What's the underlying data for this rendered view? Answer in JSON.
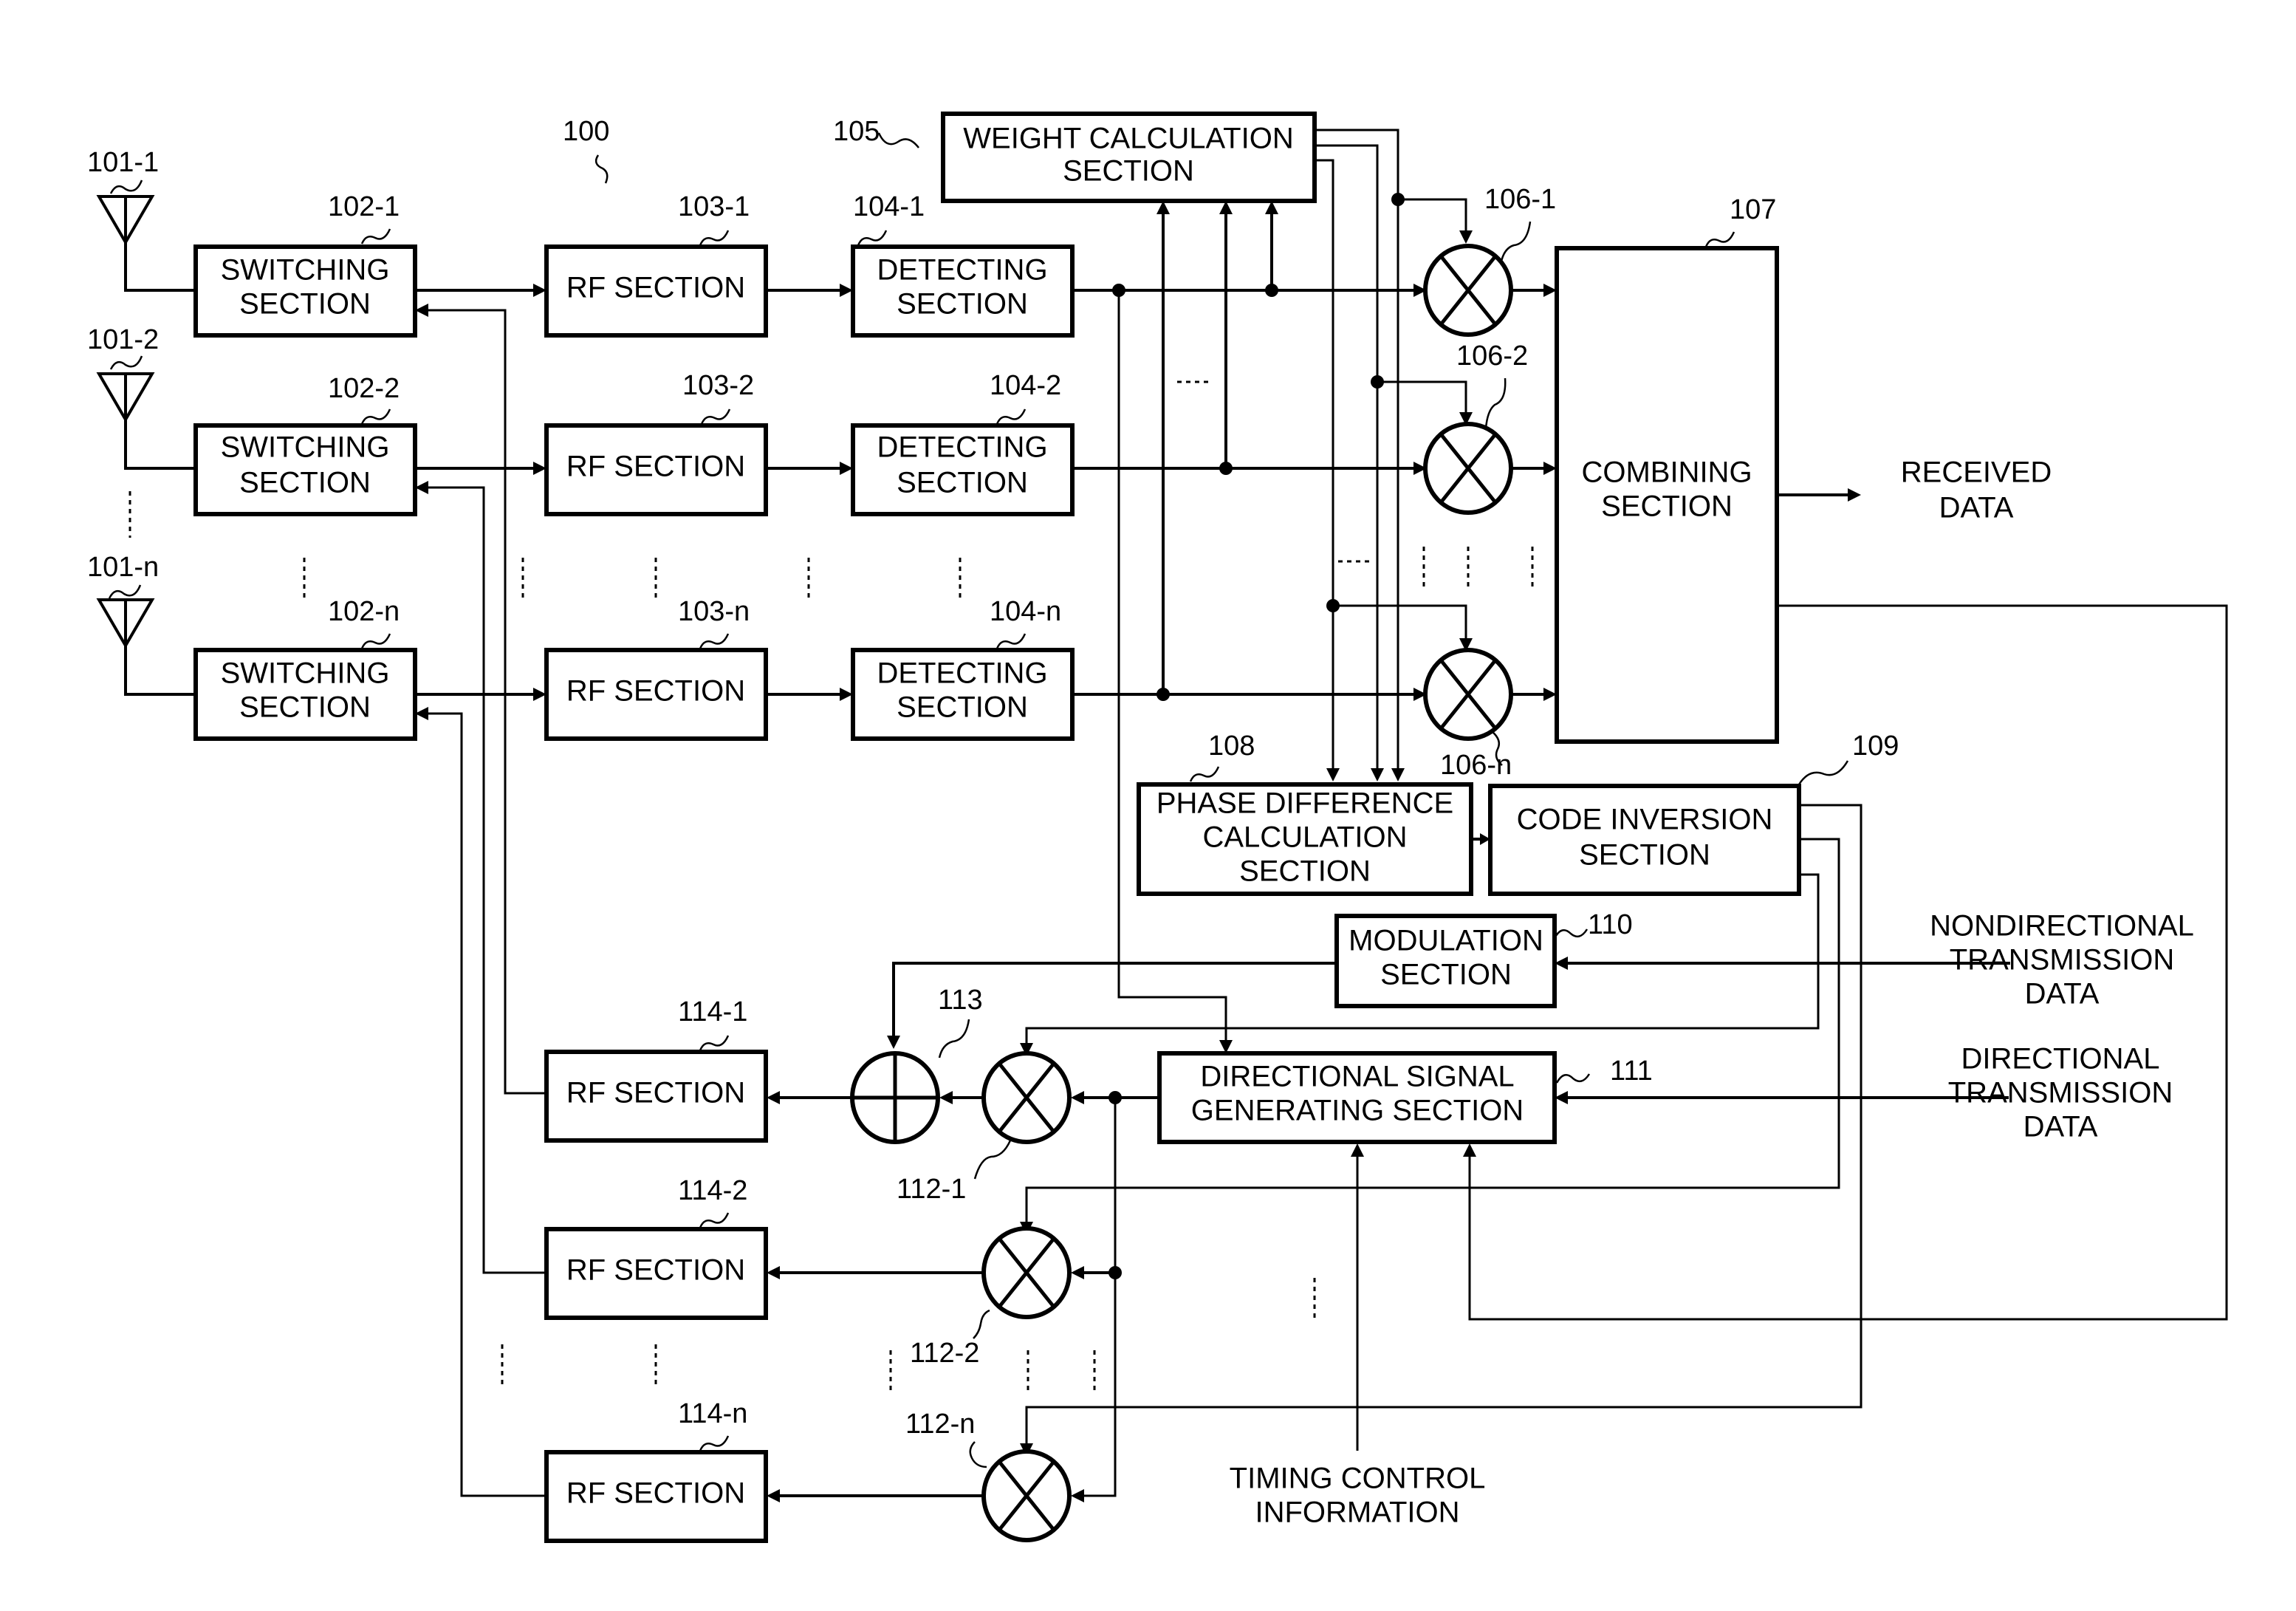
{
  "figure": {
    "ref_main": "100",
    "antennas": [
      {
        "ref": "101-1"
      },
      {
        "ref": "101-2"
      },
      {
        "ref": "101-n"
      }
    ],
    "switching": [
      {
        "ref": "102-1",
        "line1": "SWITCHING",
        "line2": "SECTION"
      },
      {
        "ref": "102-2",
        "line1": "SWITCHING",
        "line2": "SECTION"
      },
      {
        "ref": "102-n",
        "line1": "SWITCHING",
        "line2": "SECTION"
      }
    ],
    "rf_rx": [
      {
        "ref": "103-1",
        "label": "RF SECTION"
      },
      {
        "ref": "103-2",
        "label": "RF SECTION"
      },
      {
        "ref": "103-n",
        "label": "RF SECTION"
      }
    ],
    "detecting": [
      {
        "ref": "104-1",
        "line1": "DETECTING",
        "line2": "SECTION"
      },
      {
        "ref": "104-2",
        "line1": "DETECTING",
        "line2": "SECTION"
      },
      {
        "ref": "104-n",
        "line1": "DETECTING",
        "line2": "SECTION"
      }
    ],
    "weight": {
      "ref": "105",
      "line1": "WEIGHT CALCULATION",
      "line2": "SECTION"
    },
    "multipliers_rx": [
      {
        "ref": "106-1"
      },
      {
        "ref": "106-2"
      },
      {
        "ref": "106-n"
      }
    ],
    "combining": {
      "ref": "107",
      "line1": "COMBINING",
      "line2": "SECTION"
    },
    "received": {
      "line1": "RECEIVED",
      "line2": "DATA"
    },
    "phase_diff": {
      "ref": "108",
      "line1": "PHASE DIFFERENCE",
      "line2": "CALCULATION",
      "line3": "SECTION"
    },
    "code_inv": {
      "ref": "109",
      "line1": "CODE INVERSION",
      "line2": "SECTION"
    },
    "modulation": {
      "ref": "110",
      "line1": "MODULATION",
      "line2": "SECTION"
    },
    "directional_gen": {
      "ref": "111",
      "line1": "DIRECTIONAL SIGNAL",
      "line2": "GENERATING SECTION"
    },
    "multipliers_tx": [
      {
        "ref": "112-1"
      },
      {
        "ref": "112-2"
      },
      {
        "ref": "112-n"
      }
    ],
    "adder": {
      "ref": "113"
    },
    "rf_tx": [
      {
        "ref": "114-1",
        "label": "RF SECTION"
      },
      {
        "ref": "114-2",
        "label": "RF SECTION"
      },
      {
        "ref": "114-n",
        "label": "RF SECTION"
      }
    ],
    "nondirectional_input": {
      "line1": "NONDIRECTIONAL",
      "line2": "TRANSMISSION",
      "line3": "DATA"
    },
    "directional_input": {
      "line1": "DIRECTIONAL",
      "line2": "TRANSMISSION",
      "line3": "DATA"
    },
    "timing": {
      "line1": "TIMING CONTROL",
      "line2": "INFORMATION"
    }
  }
}
